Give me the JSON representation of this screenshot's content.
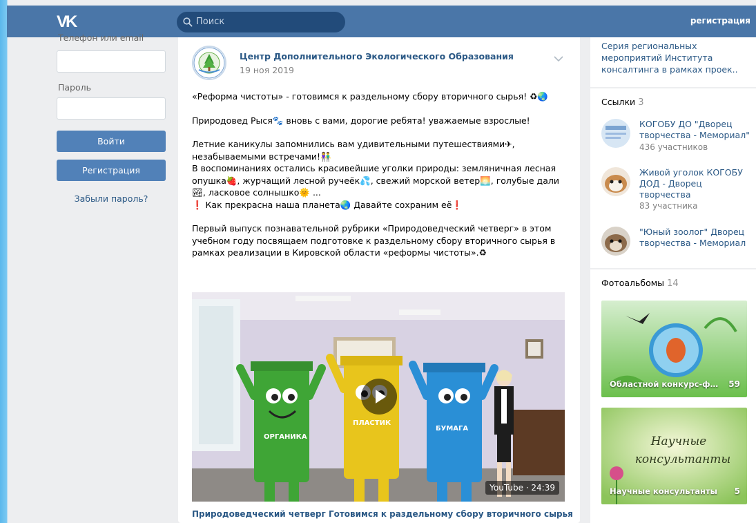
{
  "header": {
    "logo": "VK",
    "search_placeholder": "Поиск",
    "register_link": "регистрация"
  },
  "login": {
    "phone_label": "Телефон или email",
    "password_label": "Пароль",
    "login_button": "Войти",
    "register_button": "Регистрация",
    "forgot_link": "Забыли пароль?"
  },
  "post": {
    "author": "Центр Дополнительного Экологического Образования",
    "date": "19 ноя 2019",
    "paragraphs": [
      "«Реформа чистоты» - готовимся к раздельному сбору вторичного сырья! ♻🌏",
      "Природовед Рыся🐾 вновь с вами, дорогие ребята! уважаемые взрослые!",
      "Летние каникулы запомнились вам удивительными путешествиями✈, незабываемыми встречами!👫",
      "В воспоминаниях остались красивейшие уголки природы: земляничная лесная опушка🍓, журчащий лесной ручеёк💦, свежий морской ветер🌅, голубые дали🏞, ласковое солнышко🌞 ...",
      "❗ Как прекрасна наша планета🌏 Давайте сохраним её❗",
      "Первый выпуск познавательной рубрики «Природоведческий четверг» в этом учебном году посвящаем подготовке к раздельному сбору вторичного сырья в рамках реализации в Кировской области «реформы чистоты».♻"
    ],
    "video": {
      "badge": "YouTube · 24:39",
      "title": "Природоведческий четверг Готовимся к раздельному сбору вторичного сырья",
      "bin_labels": [
        "ОРГАНИКА",
        "ПЛАСТИК",
        "БУМАГА"
      ]
    }
  },
  "sidebar": {
    "top_text": "Серия региональных мероприятий Института консалтинга в рамках проек..",
    "links_title": "Ссылки",
    "links_count": "3",
    "links": [
      {
        "name": "КОГОБУ ДО \"Дворец творчества - Мемориал\"",
        "sub": "436 участников"
      },
      {
        "name": "Живой уголок КОГОБУ ДОД - Дворец творчества",
        "sub": "83 участника"
      },
      {
        "name": "\"Юный зоолог\" Дворец творчества - Мемориал",
        "sub": ""
      }
    ],
    "albums_title": "Фотоальбомы",
    "albums_count": "14",
    "albums": [
      {
        "label": "Областной конкурс-фес...",
        "count": "59"
      },
      {
        "label": "Научные консультанты",
        "count": "5",
        "cover_text_1": "Научные",
        "cover_text_2": "консультанты"
      }
    ]
  }
}
